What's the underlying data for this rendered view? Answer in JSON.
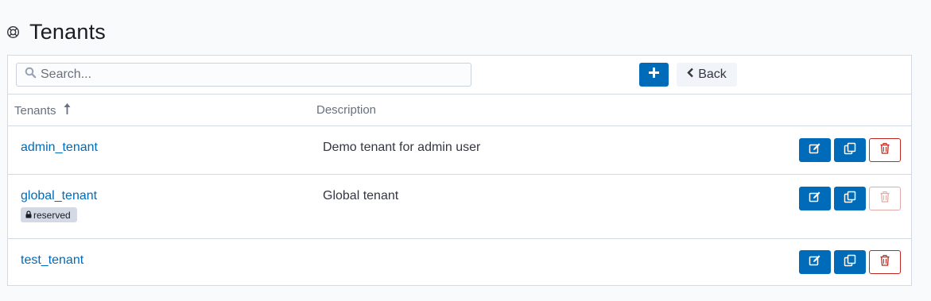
{
  "header": {
    "title": "Tenants",
    "icon": "tenants-icon"
  },
  "toolbar": {
    "search_placeholder": "Search...",
    "add_icon": "plus-icon",
    "back_label": "Back"
  },
  "table": {
    "columns": [
      "Tenants",
      "Description"
    ],
    "sort": {
      "column": "Tenants",
      "direction": "ascending"
    },
    "rows": [
      {
        "name": "admin_tenant",
        "description": "Demo tenant for admin user",
        "reserved": false,
        "delete_enabled": true
      },
      {
        "name": "global_tenant",
        "description": "Global tenant",
        "reserved": true,
        "badge": "reserved",
        "delete_enabled": false
      },
      {
        "name": "test_tenant",
        "description": "",
        "reserved": false,
        "delete_enabled": true
      }
    ]
  },
  "colors": {
    "primary": "#006bb8",
    "danger": "#bd271e",
    "badge_bg": "#d3dae6"
  }
}
